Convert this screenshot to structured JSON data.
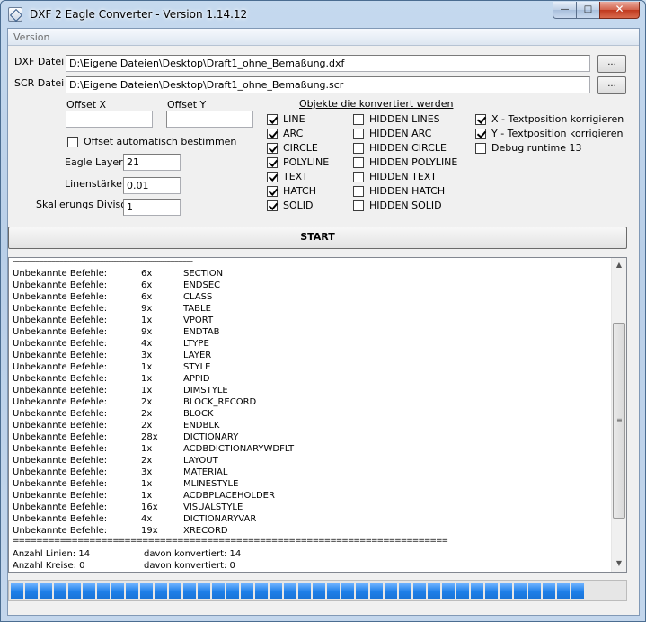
{
  "window": {
    "title": "DXF 2 Eagle Converter - Version 1.14.12"
  },
  "titlebar": {
    "minimize": "—",
    "maximize": "□",
    "close": "✕"
  },
  "menu": {
    "items": [
      "Version"
    ]
  },
  "files": {
    "dxf_label": "DXF Datei",
    "dxf_value": "D:\\Eigene Dateien\\Desktop\\Draft1_ohne_Bemaßung.dxf",
    "scr_label": "SCR Datei",
    "scr_value": "D:\\Eigene Dateien\\Desktop\\Draft1_ohne_Bemaßung.scr",
    "browse_label": "..."
  },
  "offset": {
    "x_label": "Offset X",
    "x_value": "",
    "y_label": "Offset Y",
    "y_value": "",
    "auto_label": "Offset automatisch bestimmen",
    "auto_checked": false
  },
  "params": {
    "layer_label": "Eagle Layer:",
    "layer_value": "21",
    "width_label": "Linenstärke:",
    "width_value": "0.01",
    "divisor_label": "Skalierungs Divisor",
    "divisor_value": "1"
  },
  "objects": {
    "title": "Objekte die konvertiert werden",
    "col1": [
      {
        "label": "LINE",
        "checked": true
      },
      {
        "label": "ARC",
        "checked": true
      },
      {
        "label": "CIRCLE",
        "checked": true
      },
      {
        "label": "POLYLINE",
        "checked": true
      },
      {
        "label": "TEXT",
        "checked": true
      },
      {
        "label": "HATCH",
        "checked": true
      },
      {
        "label": "SOLID",
        "checked": true
      }
    ],
    "col2": [
      {
        "label": "HIDDEN LINES",
        "checked": false
      },
      {
        "label": "HIDDEN ARC",
        "checked": false
      },
      {
        "label": "HIDDEN CIRCLE",
        "checked": false
      },
      {
        "label": "HIDDEN POLYLINE",
        "checked": false
      },
      {
        "label": "HIDDEN TEXT",
        "checked": false
      },
      {
        "label": "HIDDEN HATCH",
        "checked": false
      },
      {
        "label": "HIDDEN SOLID",
        "checked": false
      }
    ],
    "col3": [
      {
        "label": "X - Textposition korrigieren",
        "checked": true
      },
      {
        "label": "Y - Textposition korrigieren",
        "checked": true
      },
      {
        "label": "Debug runtime 13",
        "checked": false
      }
    ]
  },
  "start_label": "START",
  "log": {
    "separator_top": "-----------------------------------------------------------------------------------------",
    "rows": [
      [
        "Unbekannte Befehle:",
        "6x",
        "SECTION"
      ],
      [
        "Unbekannte Befehle:",
        "6x",
        "ENDSEC"
      ],
      [
        "Unbekannte Befehle:",
        "6x",
        "CLASS"
      ],
      [
        "Unbekannte Befehle:",
        "9x",
        "TABLE"
      ],
      [
        "Unbekannte Befehle:",
        "1x",
        "VPORT"
      ],
      [
        "Unbekannte Befehle:",
        "9x",
        "ENDTAB"
      ],
      [
        "Unbekannte Befehle:",
        "4x",
        "LTYPE"
      ],
      [
        "Unbekannte Befehle:",
        "3x",
        "LAYER"
      ],
      [
        "Unbekannte Befehle:",
        "1x",
        "STYLE"
      ],
      [
        "Unbekannte Befehle:",
        "1x",
        "APPID"
      ],
      [
        "Unbekannte Befehle:",
        "1x",
        "DIMSTYLE"
      ],
      [
        "Unbekannte Befehle:",
        "2x",
        "BLOCK_RECORD"
      ],
      [
        "Unbekannte Befehle:",
        "2x",
        "BLOCK"
      ],
      [
        "Unbekannte Befehle:",
        "2x",
        "ENDBLK"
      ],
      [
        "Unbekannte Befehle:",
        "28x",
        "DICTIONARY"
      ],
      [
        "Unbekannte Befehle:",
        "1x",
        "ACDBDICTIONARYWDFLT"
      ],
      [
        "Unbekannte Befehle:",
        "2x",
        "LAYOUT"
      ],
      [
        "Unbekannte Befehle:",
        "3x",
        "MATERIAL"
      ],
      [
        "Unbekannte Befehle:",
        "1x",
        "MLINESTYLE"
      ],
      [
        "Unbekannte Befehle:",
        "1x",
        "ACDBPLACEHOLDER"
      ],
      [
        "Unbekannte Befehle:",
        "16x",
        "VISUALSTYLE"
      ],
      [
        "Unbekannte Befehle:",
        "4x",
        "DICTIONARYVAR"
      ],
      [
        "Unbekannte Befehle:",
        "19x",
        "XRECORD"
      ]
    ],
    "separator_bottom": "==========================================================================",
    "summary": [
      [
        "Anzahl Linien: 14",
        "davon konvertiert: 14"
      ],
      [
        "Anzahl Kreise: 0",
        "davon konvertiert: 0"
      ]
    ]
  },
  "progress": {
    "value": 0.94,
    "color": "#1e7fe8"
  }
}
